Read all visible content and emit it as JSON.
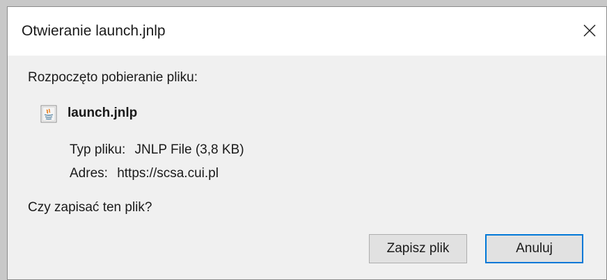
{
  "dialog": {
    "title": "Otwieranie launch.jnlp",
    "close_icon": "close-icon",
    "intro": "Rozpoczęto pobieranie pliku:",
    "file": {
      "icon": "java-file-icon",
      "name": "launch.jnlp"
    },
    "type_label": "Typ pliku:",
    "type_value": "JNLP File (3,8 KB)",
    "address_label": "Adres:",
    "address_value": "https://scsa.cui.pl",
    "question": "Czy zapisać ten plik?",
    "buttons": {
      "save": "Zapisz plik",
      "cancel": "Anuluj"
    }
  },
  "colors": {
    "focus_border": "#0078d7",
    "dialog_bg": "#f0f0f0",
    "titlebar_bg": "#ffffff"
  }
}
